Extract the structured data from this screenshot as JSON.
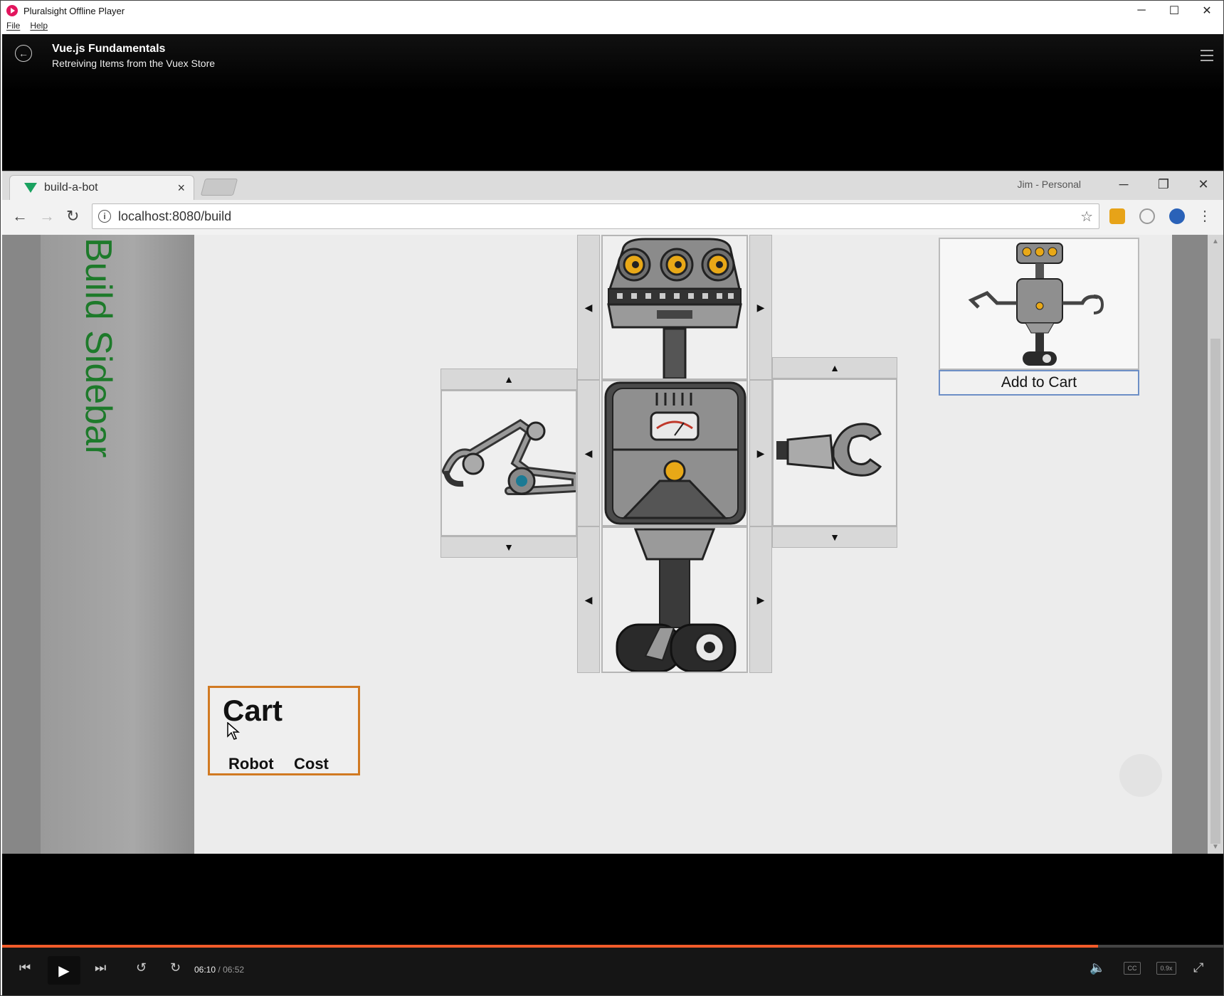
{
  "window": {
    "title": "Pluralsight Offline Player",
    "controls": [
      "─",
      "☐",
      "✕"
    ]
  },
  "menu": {
    "items": [
      "File",
      "Help"
    ]
  },
  "header": {
    "course_title": "Vue.js Fundamentals",
    "module_title": "Retreiving Items from the Vuex Store"
  },
  "browser": {
    "tab_title": "build-a-bot",
    "tab_close": "×",
    "profile": "Jim - Personal",
    "url": "localhost:8080/build",
    "controls": [
      "─",
      "❐",
      "✕"
    ]
  },
  "page": {
    "sidebar_text": "Build Sidebar",
    "add_to_cart_label": "Add to Cart",
    "cart": {
      "title": "Cart",
      "columns": [
        "Robot",
        "Cost"
      ]
    },
    "arrows": {
      "left": "◀",
      "right": "▶",
      "up": "▲",
      "down": "▼"
    }
  },
  "player": {
    "current_time": "06:10",
    "separator": "/",
    "duration": "06:52",
    "progress_fraction": 0.8977,
    "cc_label": "CC",
    "speed_label": "0.9x",
    "accent_color": "#f15b2a"
  }
}
